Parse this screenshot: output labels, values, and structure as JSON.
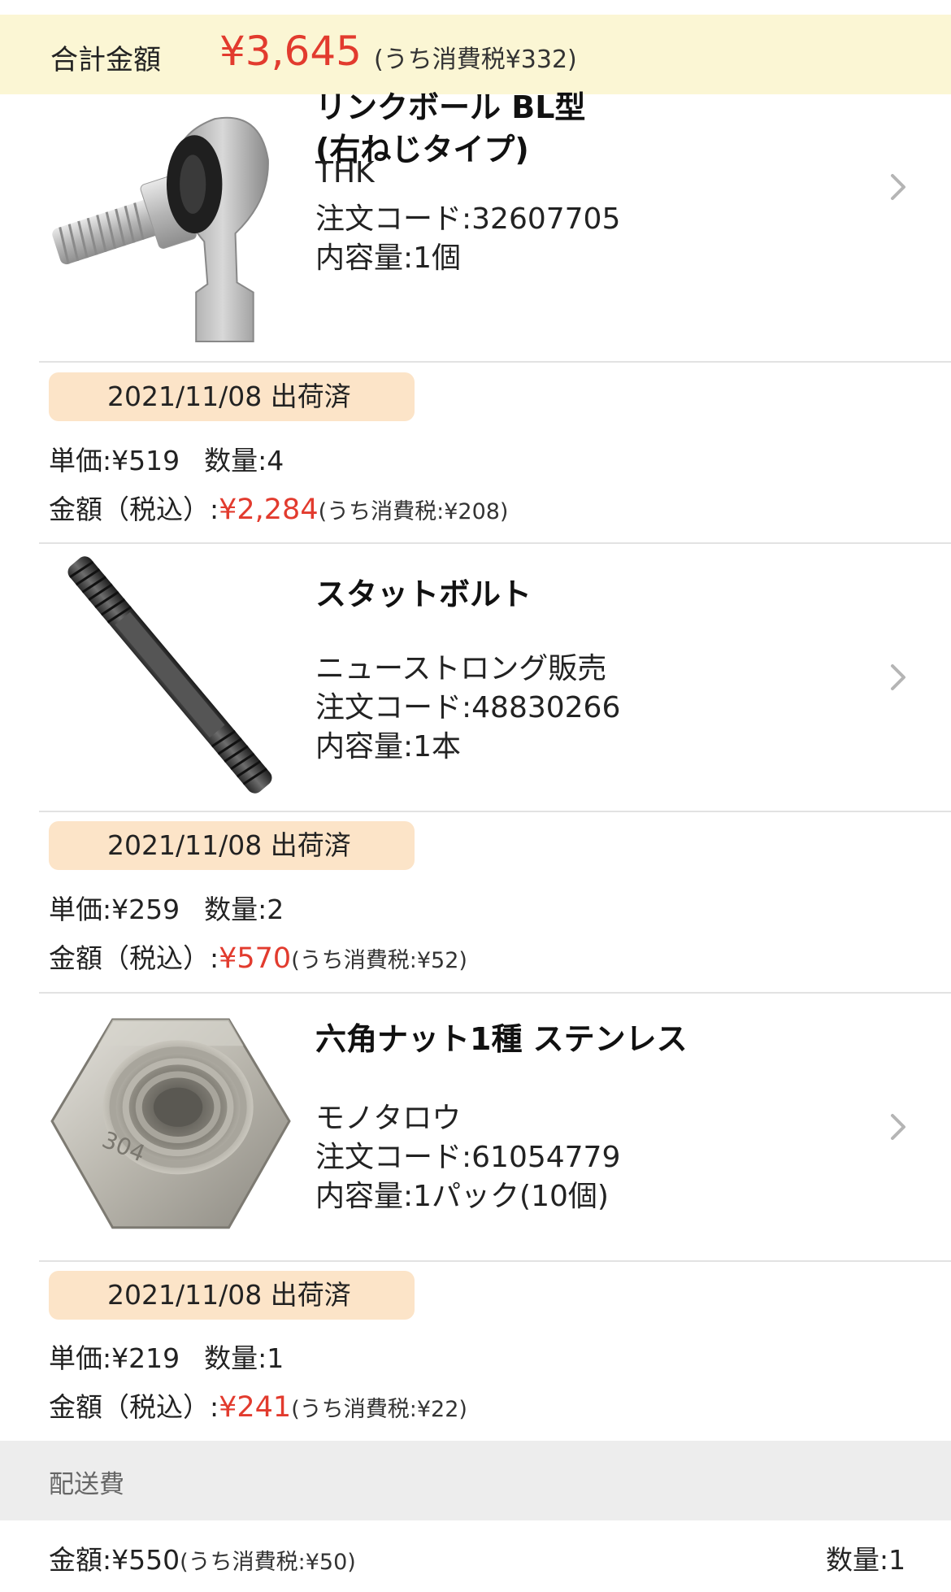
{
  "summary": {
    "total_label": "合計金額",
    "total_amount": "¥3,645",
    "total_tax": "(うち消費税¥332)"
  },
  "items": [
    {
      "title_line1": "リンクボール BL型",
      "title_line2": "(右ねじタイプ)",
      "maker": "THK",
      "code": "注文コード:32607705",
      "content": "内容量:1個",
      "image_icon": "rod-end-image",
      "status": "2021/11/08  出荷済",
      "unit_price": "単価:¥519",
      "quantity": "数量:4",
      "amount_label": "金額（税込）:",
      "amount": "¥2,284",
      "amount_tax": "(うち消費税:¥208)"
    },
    {
      "title_line1": "スタットボルト",
      "maker": "ニューストロング販売",
      "code": "注文コード:48830266",
      "content": "内容量:1本",
      "image_icon": "stud-bolt-image",
      "status": "2021/11/08  出荷済",
      "unit_price": "単価:¥259",
      "quantity": "数量:2",
      "amount_label": "金額（税込）:",
      "amount": "¥570",
      "amount_tax": "(うち消費税:¥52)"
    },
    {
      "title_line1": "六角ナット1種 ステンレス",
      "maker": "モノタロウ",
      "code": "注文コード:61054779",
      "content": "内容量:1パック(10個)",
      "image_icon": "hex-nut-image",
      "image_text": "304",
      "status": "2021/11/08  出荷済",
      "unit_price": "単価:¥219",
      "quantity": "数量:1",
      "amount_label": "金額（税込）:",
      "amount": "¥241",
      "amount_tax": "(うち消費税:¥22)"
    }
  ],
  "shipping": {
    "label": "配送費",
    "amount_label": "金額:¥550",
    "amount_tax": "(うち消費税:¥50)",
    "quantity": "数量:1"
  },
  "colors": {
    "accent_red": "#e23b2e",
    "summary_bg": "#fbf6d4",
    "badge_bg": "#fce4c8",
    "section_bg": "#ededed"
  }
}
